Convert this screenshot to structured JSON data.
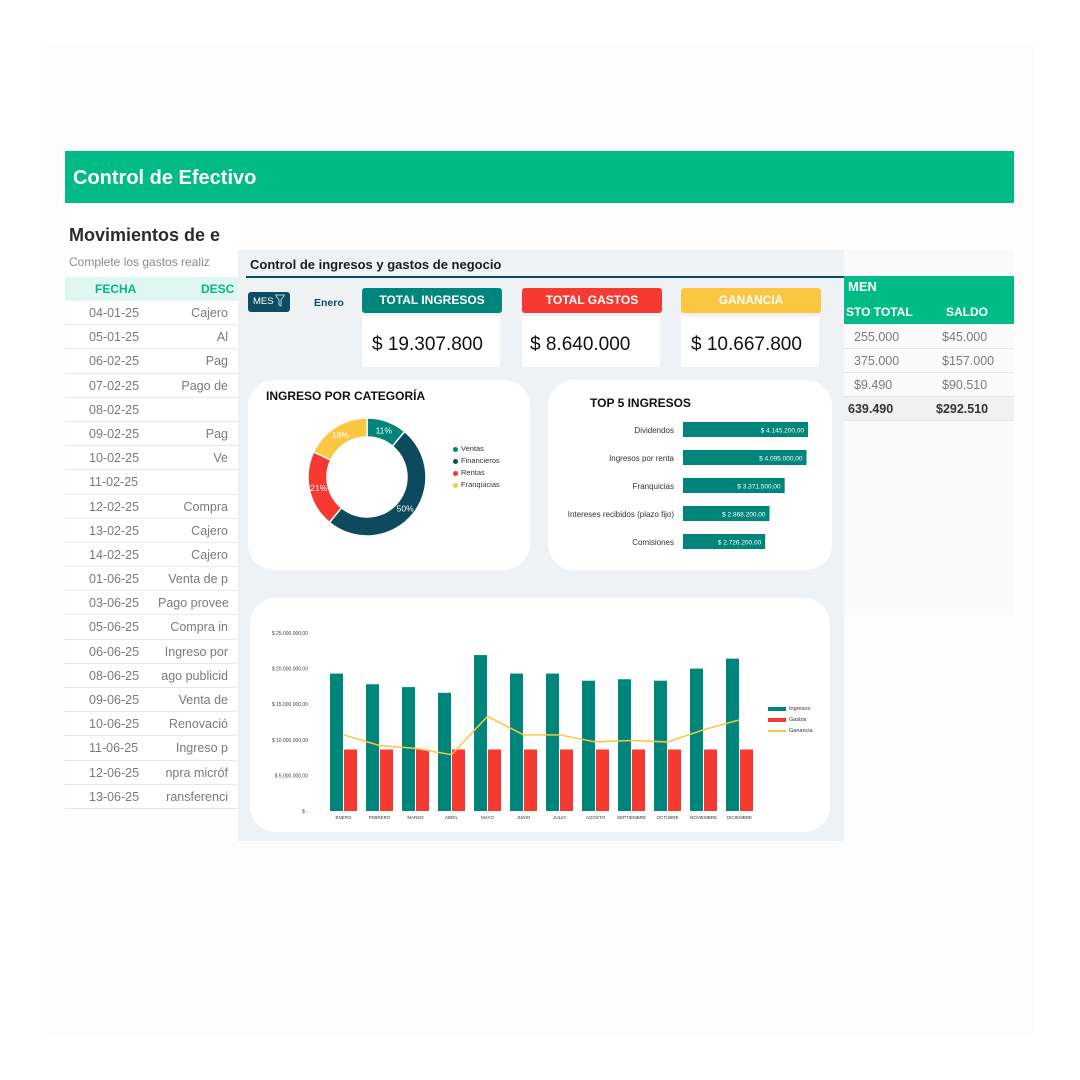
{
  "app": {
    "title": "Control de Efectivo"
  },
  "movements": {
    "title": "Movimientos de e",
    "subtitle": "Complete los gastos realiz",
    "headers": [
      "FECHA",
      "DESC"
    ],
    "rows": [
      {
        "date": "04-01-25",
        "desc": "Cajero"
      },
      {
        "date": "05-01-25",
        "desc": "Al"
      },
      {
        "date": "06-02-25",
        "desc": "Pag"
      },
      {
        "date": "07-02-25",
        "desc": "Pago de"
      },
      {
        "date": "08-02-25",
        "desc": ""
      },
      {
        "date": "09-02-25",
        "desc": "Pag"
      },
      {
        "date": "10-02-25",
        "desc": "Ve"
      },
      {
        "date": "11-02-25",
        "desc": ""
      },
      {
        "date": "12-02-25",
        "desc": "Compra"
      },
      {
        "date": "13-02-25",
        "desc": "Cajero"
      },
      {
        "date": "14-02-25",
        "desc": "Cajero"
      },
      {
        "date": "01-06-25",
        "desc": "Venta de p"
      },
      {
        "date": "03-06-25",
        "desc": "Pago provee"
      },
      {
        "date": "05-06-25",
        "desc": "Compra in"
      },
      {
        "date": "06-06-25",
        "desc": "Ingreso por"
      },
      {
        "date": "08-06-25",
        "desc": "ago publicid"
      },
      {
        "date": "09-06-25",
        "desc": "Venta de"
      },
      {
        "date": "10-06-25",
        "desc": "Renovació"
      },
      {
        "date": "11-06-25",
        "desc": "Ingreso p"
      },
      {
        "date": "12-06-25",
        "desc": "npra micróf"
      },
      {
        "date": "13-06-25",
        "desc": "ransferenci"
      }
    ]
  },
  "summary": {
    "title": "MEN",
    "headers": [
      "STO TOTAL",
      "SALDO"
    ],
    "rows": [
      {
        "total": "255.000",
        "saldo": "$45.000"
      },
      {
        "total": "375.000",
        "saldo": "$157.000"
      },
      {
        "total": "$9.490",
        "saldo": "$90.510"
      }
    ],
    "totals": {
      "total": "639.490",
      "saldo": "$292.510"
    }
  },
  "dashboard": {
    "title": "Control de ingresos y gastos de negocio",
    "filter": {
      "label": "MES",
      "value": "Enero"
    },
    "kpis": [
      {
        "label": "TOTAL INGRESOS",
        "value": "$ 19.307.800",
        "color": "#00857b"
      },
      {
        "label": "TOTAL GASTOS",
        "value": "$ 8.640.000",
        "color": "#f63a32"
      },
      {
        "label": "GANANCIA",
        "value": "$ 10.667.800",
        "color": "#fbc640"
      }
    ],
    "category_title": "INGRESO POR CATEGORÍA",
    "top_title": "TOP 5 INGRESOS"
  },
  "chart_data": [
    {
      "type": "pie",
      "title": "INGRESO POR CATEGORÍA",
      "categories": [
        "Ventas",
        "Financieros",
        "Rentas",
        "Franquicias"
      ],
      "values": [
        11,
        50,
        21,
        18
      ],
      "labels": [
        "11%",
        "50%",
        "21%",
        "18%"
      ],
      "colors": [
        "#00857b",
        "#0d4a5e",
        "#f63a32",
        "#fbc640"
      ]
    },
    {
      "type": "bar",
      "title": "TOP 5 INGRESOS",
      "orientation": "horizontal",
      "categories": [
        "Dividendos",
        "Ingresos por renta",
        "Franquicias",
        "Intereses recibidos (plazo fijo)",
        "Comisiones"
      ],
      "values": [
        4145200,
        4095000,
        3371500,
        2868200,
        2726200
      ],
      "labels": [
        "$ 4.145.200,00",
        "$ 4.095.000,00",
        "$ 3.371.500,00",
        "$ 2.868.200,00",
        "$ 2.726.200,00"
      ],
      "color": "#00857b"
    },
    {
      "type": "bar",
      "categories": [
        "ENERO",
        "FEBRERO",
        "MARZO",
        "ABRIL",
        "MAYO",
        "JUNIO",
        "JULIO",
        "AGOSTO",
        "SEPTIEMBRE",
        "OCTUBRE",
        "NOVIEMBRE",
        "DICIEMBRE"
      ],
      "series": [
        {
          "name": "Ingresos",
          "kind": "bar",
          "color": "#00857b",
          "values": [
            19300000,
            17800000,
            17400000,
            16600000,
            21900000,
            19300000,
            19300000,
            18300000,
            18500000,
            18300000,
            20000000,
            21400000
          ]
        },
        {
          "name": "Gastos",
          "kind": "bar",
          "color": "#f63a32",
          "values": [
            8640000,
            8640000,
            8640000,
            8640000,
            8640000,
            8640000,
            8640000,
            8640000,
            8640000,
            8640000,
            8640000,
            8640000
          ]
        },
        {
          "name": "Ganancia",
          "kind": "line",
          "color": "#fbc640",
          "values": [
            10700000,
            9200000,
            8800000,
            7900000,
            13300000,
            10700000,
            10700000,
            9700000,
            9900000,
            9700000,
            11400000,
            12800000
          ]
        }
      ],
      "ylim": [
        0,
        25000000
      ],
      "yticks": [
        "$ -",
        "$ 5.000.000,00",
        "$ 10.000.000,00",
        "$ 15.000.000,00",
        "$ 20.000.000,00",
        "$ 25.000.000,00"
      ],
      "legend": "right"
    }
  ]
}
